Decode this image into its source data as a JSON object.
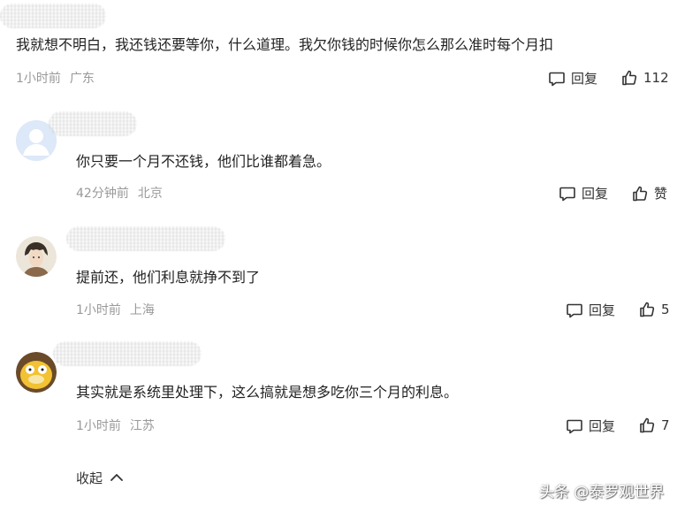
{
  "comments": [
    {
      "text": "我就想不明白，我还钱还要等你，什么道理。我欠你钱的时候你怎么那么准时每个月扣",
      "time": "1小时前",
      "location": "广东",
      "reply_label": "回复",
      "like_label": "112"
    },
    {
      "text": "你只要一个月不还钱，他们比谁都着急。",
      "time": "42分钟前",
      "location": "北京",
      "reply_label": "回复",
      "like_label": "赞"
    },
    {
      "text": "提前还，他们利息就挣不到了",
      "time": "1小时前",
      "location": "上海",
      "reply_label": "回复",
      "like_label": "5"
    },
    {
      "text": "其实就是系统里处理下，这么搞就是想多吃你三个月的利息。",
      "time": "1小时前",
      "location": "江苏",
      "reply_label": "回复",
      "like_label": "7"
    }
  ],
  "collapse_label": "收起",
  "watermark": "头条 @泰罗观世界",
  "icons": {
    "reply": "comment-bubble-icon",
    "like": "thumbs-up-icon",
    "collapse": "chevron-up-icon"
  },
  "colors": {
    "text": "#222222",
    "meta": "#999999",
    "action": "#333333"
  }
}
